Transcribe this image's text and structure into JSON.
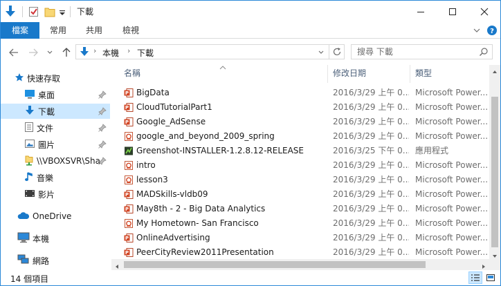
{
  "window": {
    "title": "下載",
    "accent": "#1979ca"
  },
  "ribbon": {
    "tabs": [
      {
        "label": "檔案"
      },
      {
        "label": "常用"
      },
      {
        "label": "共用"
      },
      {
        "label": "檢視"
      }
    ]
  },
  "address": {
    "crumbs": [
      "本機",
      "下載"
    ]
  },
  "search": {
    "placeholder": "搜尋 下載"
  },
  "nav": {
    "quick_access": "快速存取",
    "items": [
      {
        "label": "桌面",
        "icon": "desktop-icon",
        "pinned": true
      },
      {
        "label": "下載",
        "icon": "download-icon",
        "pinned": true,
        "selected": true
      },
      {
        "label": "文件",
        "icon": "document-icon",
        "pinned": true
      },
      {
        "label": "圖片",
        "icon": "pictures-icon",
        "pinned": true
      },
      {
        "label": "\\\\VBOXSVR\\Sha",
        "icon": "network-share-icon",
        "pinned": true
      },
      {
        "label": "音樂",
        "icon": "music-icon",
        "pinned": false
      },
      {
        "label": "影片",
        "icon": "video-icon",
        "pinned": false
      }
    ],
    "onedrive": "OneDrive",
    "this_pc": "本機",
    "network": "網路"
  },
  "columns": {
    "name": "名稱",
    "date": "修改日期",
    "type": "類型"
  },
  "files": [
    {
      "name": "BigData",
      "date": "2016/3/29 上午 0...",
      "type": "Microsoft Power...",
      "icon": "powerpoint-show-icon"
    },
    {
      "name": "CloudTutorialPart1",
      "date": "2016/3/29 上午 0...",
      "type": "Microsoft Power...",
      "icon": "powerpoint-show-icon"
    },
    {
      "name": "Google_AdSense",
      "date": "2016/3/29 上午 0...",
      "type": "Microsoft Power...",
      "icon": "powerpoint-show-icon"
    },
    {
      "name": "google_and_beyond_2009_spring",
      "date": "2016/3/29 上午 0...",
      "type": "Microsoft Power...",
      "icon": "powerpoint-doc-icon"
    },
    {
      "name": "Greenshot-INSTALLER-1.2.8.12-RELEASE",
      "date": "2016/3/25 下午 0...",
      "type": "應用程式",
      "icon": "application-icon"
    },
    {
      "name": "intro",
      "date": "2016/3/29 上午 0...",
      "type": "Microsoft Power...",
      "icon": "powerpoint-doc-icon"
    },
    {
      "name": "lesson3",
      "date": "2016/3/29 上午 0...",
      "type": "Microsoft Power...",
      "icon": "powerpoint-doc-icon"
    },
    {
      "name": "MADSkills-vldb09",
      "date": "2016/3/29 上午 0...",
      "type": "Microsoft Power...",
      "icon": "powerpoint-show-icon"
    },
    {
      "name": "May8th - 2 - Big Data Analytics",
      "date": "2016/3/29 上午 0...",
      "type": "Microsoft Power...",
      "icon": "powerpoint-show-icon"
    },
    {
      "name": "My Hometown- San Francisco",
      "date": "2016/3/29 上午 0...",
      "type": "Microsoft Power...",
      "icon": "powerpoint-doc-icon"
    },
    {
      "name": "OnlineAdvertising",
      "date": "2016/3/29 上午 0...",
      "type": "Microsoft Power...",
      "icon": "powerpoint-show-icon"
    },
    {
      "name": "PeerCityReview2011Presentation",
      "date": "2016/3/29 上午 0...",
      "type": "Microsoft Power...",
      "icon": "powerpoint-show-icon"
    }
  ],
  "status": {
    "count": "14 個項目"
  }
}
